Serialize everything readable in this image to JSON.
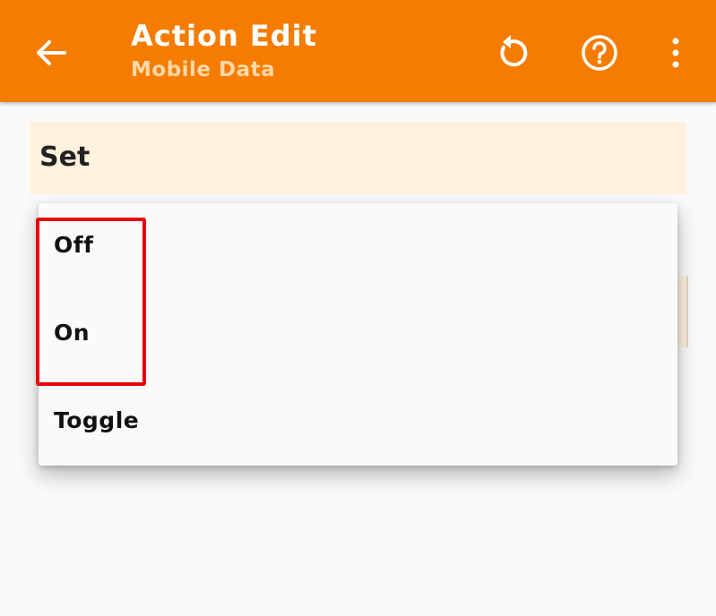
{
  "header": {
    "title": "Action Edit",
    "subtitle": "Mobile Data",
    "background_color": "#f57c00",
    "icons": [
      "back-arrow-icon",
      "reset-icon",
      "help-icon",
      "more-vert-icon"
    ]
  },
  "set_field": {
    "label": "Set",
    "background_color": "#fff2df"
  },
  "dropdown": {
    "options": [
      {
        "label": "Off"
      },
      {
        "label": "On"
      },
      {
        "label": "Toggle"
      }
    ]
  },
  "annotation": {
    "highlight_color": "#e8000b"
  }
}
